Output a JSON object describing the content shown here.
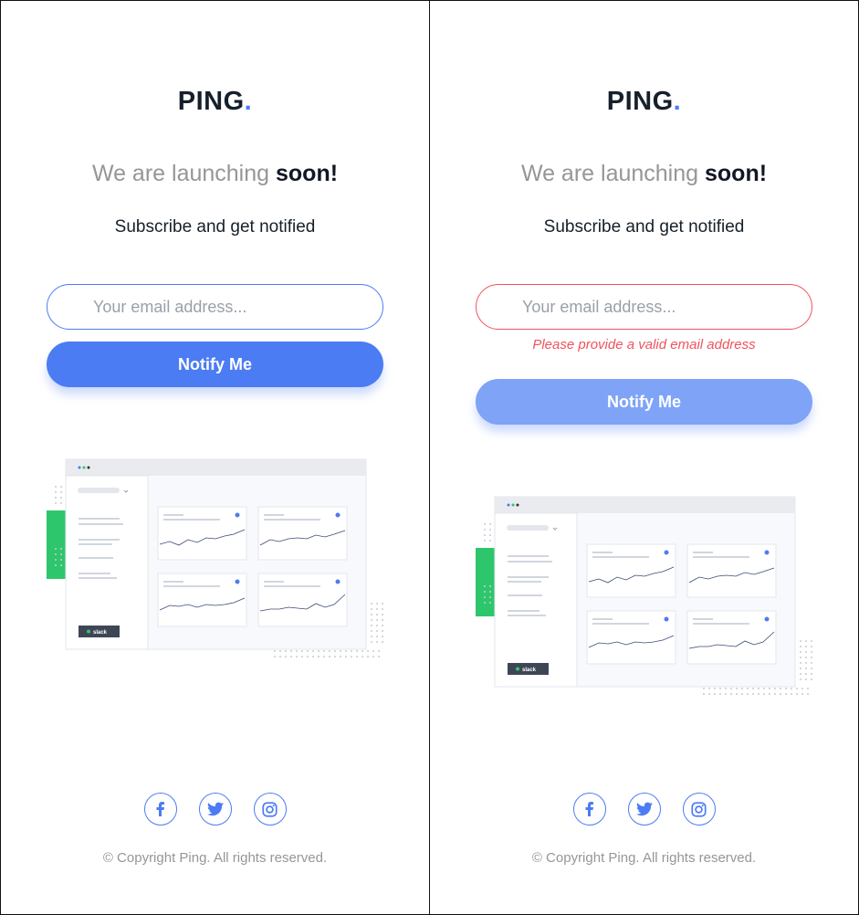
{
  "brand": {
    "name": "PING",
    "dot": ".",
    "accent": "#4c7cf3"
  },
  "headline": {
    "prefix": "We are launching ",
    "emphasis": "soon!"
  },
  "subtitle": "Subscribe and get notified",
  "form": {
    "placeholder": "Your email address...",
    "button_label": "Notify Me",
    "error_message": "Please provide a valid email address",
    "error_color": "#f0535d"
  },
  "illustration": {
    "sidebar_badge": "slack"
  },
  "socials": [
    {
      "name": "facebook-icon"
    },
    {
      "name": "twitter-icon"
    },
    {
      "name": "instagram-icon"
    }
  ],
  "footer": {
    "copyright": "© Copyright Ping. All rights reserved."
  }
}
